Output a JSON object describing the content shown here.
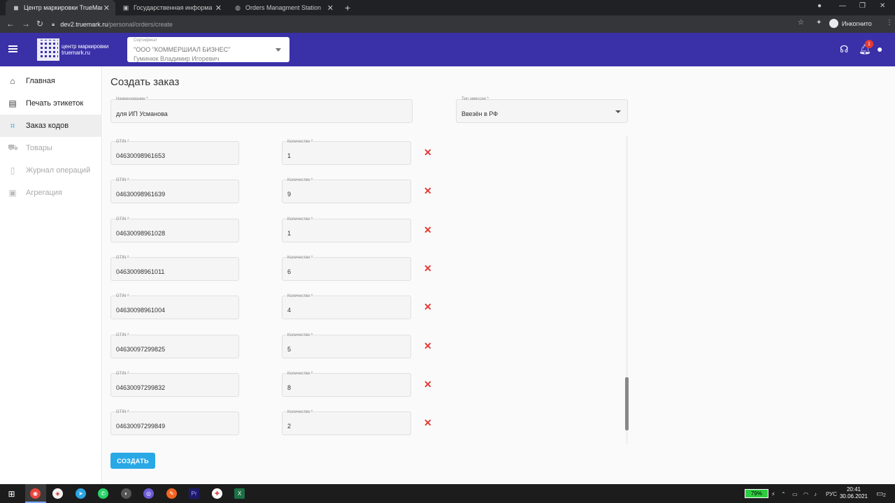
{
  "browser": {
    "tabs": [
      {
        "label": "Центр маркировки TrueMark — ЛК"
      },
      {
        "label": "Государственная информационная"
      },
      {
        "label": "Orders Managment Station"
      }
    ],
    "url_host": "dev2.truemark.ru",
    "url_path": "/personal/orders/create",
    "incognito_label": "Инкогнито"
  },
  "header": {
    "logo_line1": "центр маркировки",
    "logo_line2": "truemark.ru",
    "cert_label": "Сертификат",
    "cert_org": "\"ООО \"КОММЕРШИАЛ БИЗНЕС\"",
    "cert_person": "Гуминюк Владимир Игоревич",
    "notifications_count": "1"
  },
  "sidebar": {
    "items": [
      {
        "label": "Главная",
        "icon": "home-icon"
      },
      {
        "label": "Печать этикеток",
        "icon": "printer-icon"
      },
      {
        "label": "Заказ кодов",
        "icon": "qr-icon"
      },
      {
        "label": "Товары",
        "icon": "cart-icon"
      },
      {
        "label": "Журнал операций",
        "icon": "clipboard-icon"
      },
      {
        "label": "Агрегация",
        "icon": "box-icon"
      }
    ]
  },
  "main": {
    "title": "Создать заказ",
    "name_label": "Наименование *",
    "name_value": "для ИП Усманова",
    "emission_label": "Тип эмиссии *",
    "emission_value": "Ввезён в РФ",
    "gtin_label": "GTIN *",
    "qty_label": "Количество *",
    "rows": [
      {
        "gtin": "04630098961653",
        "qty": "1"
      },
      {
        "gtin": "04630098961639",
        "qty": "9"
      },
      {
        "gtin": "04630098961028",
        "qty": "1"
      },
      {
        "gtin": "04630098961011",
        "qty": "6"
      },
      {
        "gtin": "04630098961004",
        "qty": "4"
      },
      {
        "gtin": "04630097299825",
        "qty": "5"
      },
      {
        "gtin": "04630097299832",
        "qty": "8"
      },
      {
        "gtin": "04630097299849",
        "qty": "2"
      }
    ],
    "create_button": "СОЗДАТЬ"
  },
  "taskbar": {
    "battery": "79%",
    "lang": "РУС",
    "time": "20:41",
    "date": "30.06.2021",
    "notif_count": "2"
  }
}
